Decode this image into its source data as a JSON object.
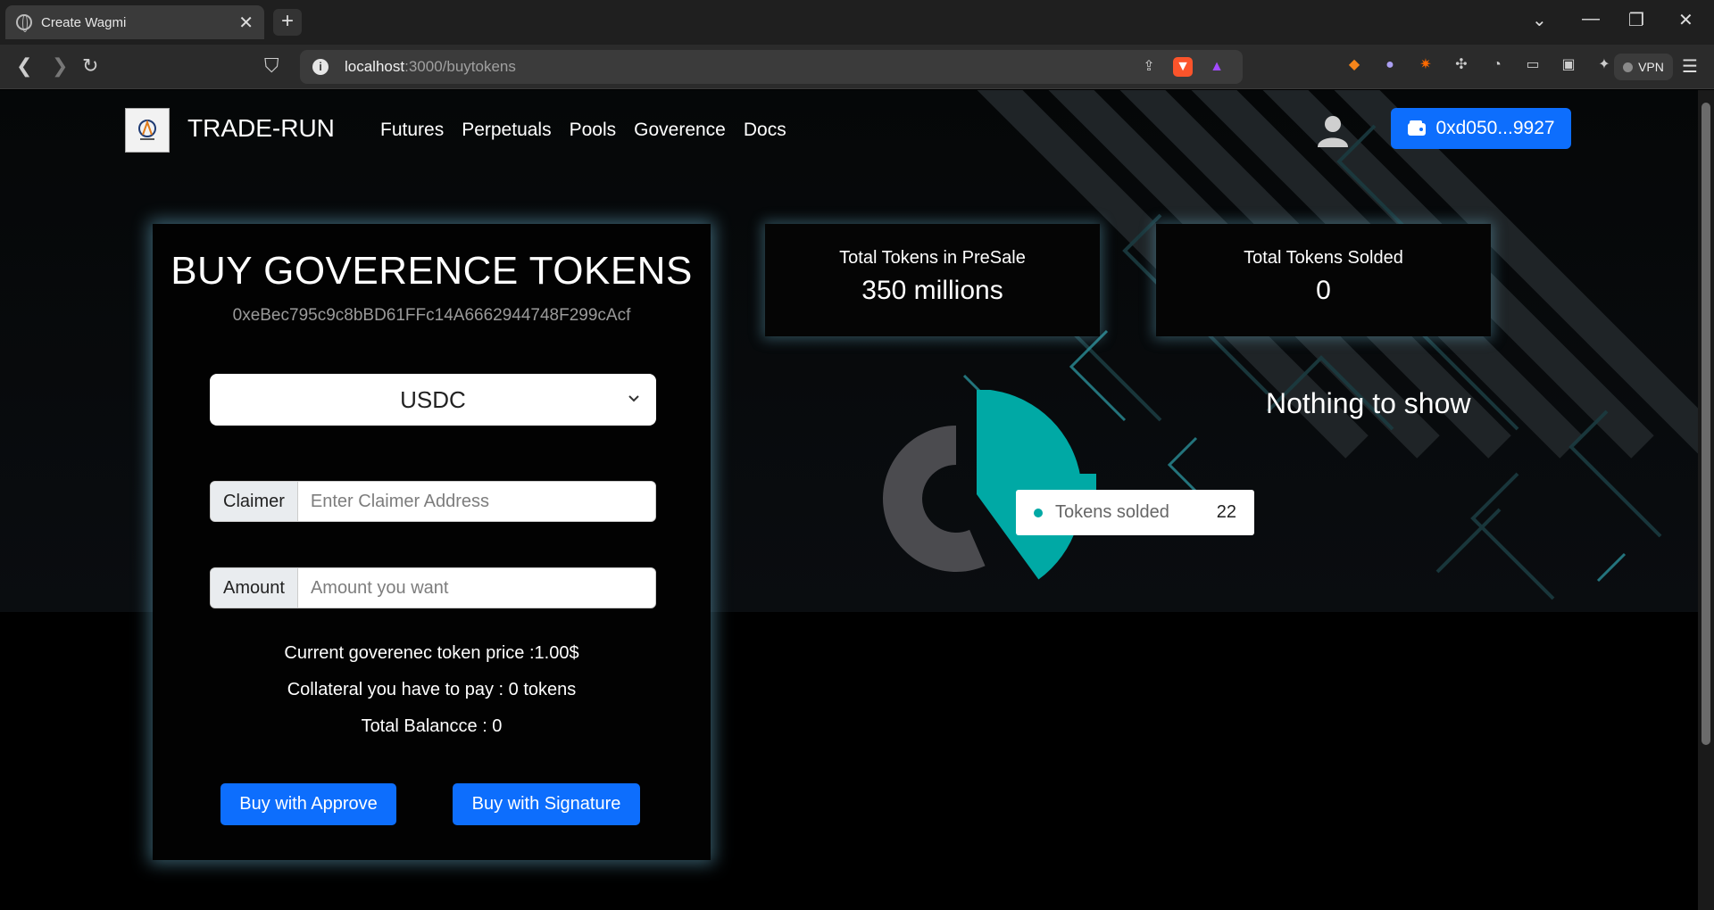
{
  "browser": {
    "tab_title": "Create Wagmi",
    "url_host": "localhost",
    "url_path": ":3000/buytokens",
    "vpn_label": "VPN"
  },
  "nav": {
    "brand": "TRADE-RUN",
    "links": [
      "Futures",
      "Perpetuals",
      "Pools",
      "Goverence",
      "Docs"
    ],
    "wallet": "0xd050...9927"
  },
  "buy": {
    "title": "BUY GOVERENCE TOKENS",
    "contract": "0xeBec795c9c8bBD61FFc14A6662944748F299cAcf",
    "token_selected": "USDC",
    "claimer_label": "Claimer",
    "claimer_placeholder": "Enter Claimer Address",
    "amount_label": "Amount",
    "amount_placeholder": "Amount you want",
    "price_line": "Current goverenec token price :1.00$",
    "collateral_line": "Collateral you have to pay : 0 tokens",
    "balance_line": "Total Balancce : 0",
    "buy_approve": "Buy with Approve",
    "buy_signature": "Buy with Signature"
  },
  "stats": {
    "presale_label": "Total Tokens in PreSale",
    "presale_value": "350 millions",
    "sold_label": "Total Tokens Solded",
    "sold_value": "0"
  },
  "empty_text": "Nothing to show",
  "chart_data": {
    "type": "pie",
    "categories": [
      "Tokens solded"
    ],
    "values": [
      22
    ],
    "tooltip": {
      "label": "Tokens solded",
      "value": "22"
    },
    "colors": {
      "highlight": "#00a9a5",
      "rest": "#4b4b4f"
    }
  },
  "colors": {
    "primary": "#0d6efd",
    "teal": "#00a9a5",
    "glow": "#78c8e6"
  }
}
